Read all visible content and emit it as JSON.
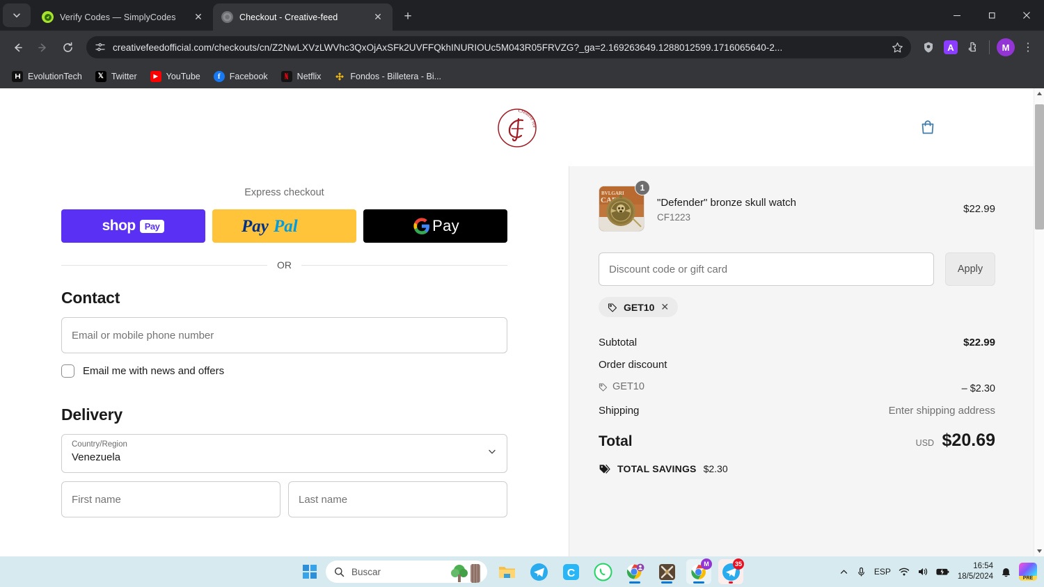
{
  "browser": {
    "tabs": [
      {
        "title": "Verify Codes — SimplyCodes",
        "favicon": "simplycodes-icon",
        "active": false
      },
      {
        "title": "Checkout - Creative-feed",
        "favicon": "creativefeed-icon",
        "active": true
      }
    ],
    "new_tab_label": "+",
    "tab_close_label": "✕",
    "tab_list_caret": "⌄",
    "window_controls": {
      "minimize": "—",
      "maximize": "❐",
      "close": "✕"
    },
    "nav": {
      "back": "←",
      "forward": "→",
      "reload": "⟳"
    },
    "omnibox": {
      "url": "creativefeedofficial.com/checkouts/cn/Z2NwLXVzLWVhc3QxOjAxSFk2UVFFQkhINURIOUc5M043R05FRVZG?_ga=2.169263649.1288012599.1716065640-2...",
      "site_settings_icon": "tune-icon",
      "bookmark_icon": "star-icon"
    },
    "toolbar_icons": [
      {
        "name": "shield-icon",
        "glyph": "shield"
      },
      {
        "name": "adblock-extension-icon",
        "glyph": "A"
      },
      {
        "name": "extensions-puzzle-icon",
        "glyph": "puzzle"
      }
    ],
    "profile_avatar": "M",
    "menu_icon": "⋮",
    "bookmarks": [
      {
        "label": "EvolutionTech",
        "icon": "evolutiontech-icon"
      },
      {
        "label": "Twitter",
        "icon": "twitter-x-icon"
      },
      {
        "label": "YouTube",
        "icon": "youtube-icon"
      },
      {
        "label": "Facebook",
        "icon": "facebook-icon"
      },
      {
        "label": "Netflix",
        "icon": "netflix-icon"
      },
      {
        "label": "Fondos - Billetera - Bi...",
        "icon": "binance-icon"
      }
    ]
  },
  "site": {
    "logo_alt": "Creative feed",
    "logo_text": "Creative feed",
    "cart_icon": "shopping-bag-icon"
  },
  "checkout": {
    "express": {
      "label": "Express checkout",
      "buttons": [
        {
          "name": "shop-pay-button",
          "text": "shop",
          "pill": "Pay"
        },
        {
          "name": "paypal-button",
          "text": "PayPal"
        },
        {
          "name": "google-pay-button",
          "text": "Pay"
        }
      ]
    },
    "or_label": "OR",
    "contact": {
      "title": "Contact",
      "email_placeholder": "Email or mobile phone number",
      "newsletter_label": "Email me with news and offers",
      "newsletter_checked": false
    },
    "delivery": {
      "title": "Delivery",
      "country_label": "Country/Region",
      "country_value": "Venezuela",
      "first_name_placeholder": "First name",
      "last_name_placeholder": "Last name"
    }
  },
  "summary": {
    "line_items": [
      {
        "title": "\"Defender\" bronze skull watch",
        "variant": "CF1223",
        "quantity": "1",
        "price": "$22.99"
      }
    ],
    "discount_placeholder": "Discount code or gift card",
    "apply_label": "Apply",
    "applied_codes": [
      {
        "code": "GET10",
        "remove_label": "✕"
      }
    ],
    "totals": [
      {
        "label": "Subtotal",
        "value": "$22.99",
        "style": "normal"
      },
      {
        "label": "Order discount",
        "value": "",
        "style": "normal"
      },
      {
        "label": "GET10",
        "value": "– $2.30",
        "style": "muted-code"
      },
      {
        "label": "Shipping",
        "value": "Enter shipping address",
        "style": "muted-value"
      }
    ],
    "total": {
      "label": "Total",
      "currency": "USD",
      "value": "$20.69"
    },
    "savings": {
      "label": "TOTAL SAVINGS",
      "value": "$2.30",
      "icon": "tag-icon"
    }
  },
  "taskbar": {
    "start_icon": "windows-start-icon",
    "search_placeholder": "Buscar",
    "apps": [
      {
        "name": "taskbar-file-explorer",
        "icon": "folder-icon",
        "running": false
      },
      {
        "name": "taskbar-telegram",
        "icon": "telegram-icon",
        "running": false
      },
      {
        "name": "taskbar-c-app",
        "icon": "c-app-icon",
        "running": false
      },
      {
        "name": "taskbar-whatsapp",
        "icon": "whatsapp-icon",
        "running": false
      },
      {
        "name": "taskbar-chrome-profile",
        "icon": "chrome-people-icon",
        "running": true
      },
      {
        "name": "taskbar-game",
        "icon": "game-icon",
        "running": true
      },
      {
        "name": "taskbar-chrome-active",
        "icon": "chrome-icon",
        "running": true,
        "badge": "M"
      },
      {
        "name": "taskbar-telegram-2",
        "icon": "telegram-icon",
        "running": true,
        "badge": "35"
      }
    ],
    "tray": {
      "overflow_icon": "chevron-up-icon",
      "mic_icon": "microphone-icon",
      "language": "ESP",
      "wifi_icon": "wifi-icon",
      "volume_icon": "volume-icon",
      "battery_icon": "battery-charging-icon",
      "time": "16:54",
      "date": "18/5/2024",
      "notification_icon": "bell-icon",
      "copilot_label": "PRE"
    }
  }
}
